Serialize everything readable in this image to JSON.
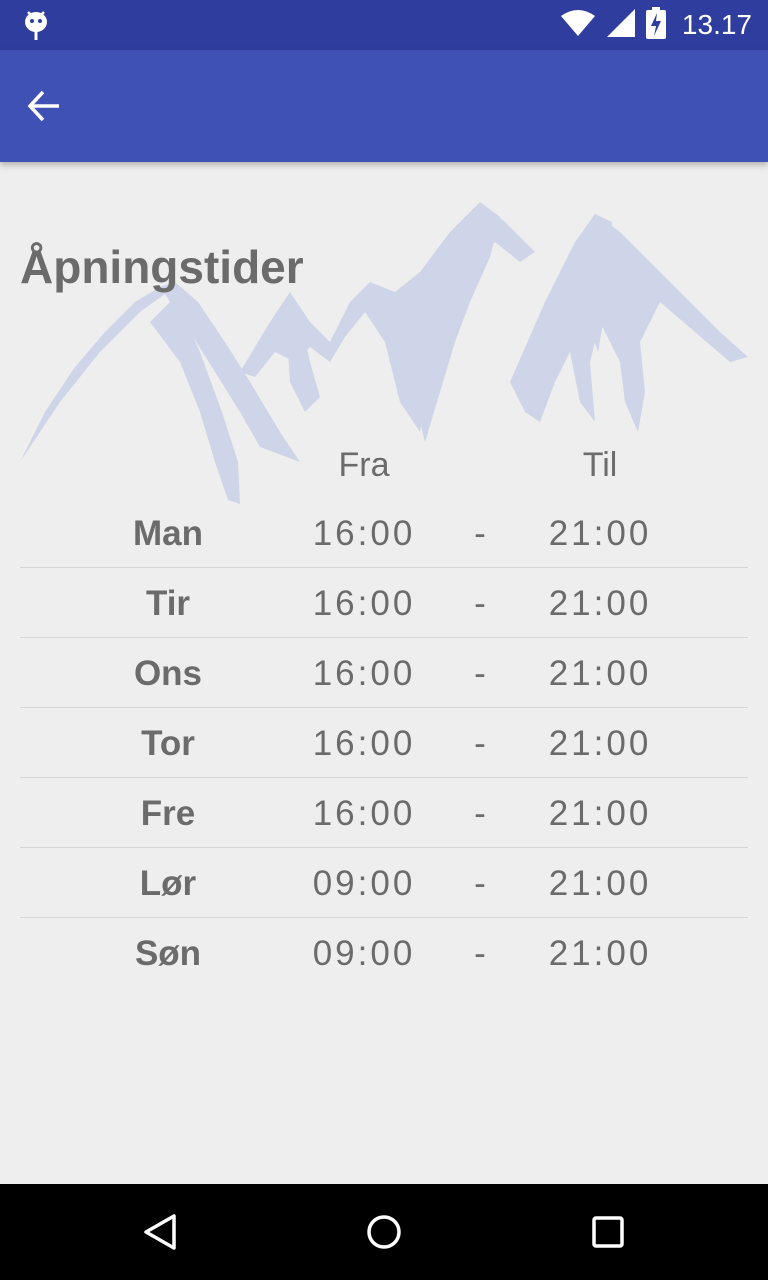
{
  "status_bar": {
    "time": "13.17",
    "icons": [
      "android-debug-icon",
      "wifi-icon",
      "cell-signal-icon",
      "battery-charging-icon"
    ]
  },
  "app_bar": {
    "back_icon": "arrow-back-icon"
  },
  "page": {
    "title": "Åpningstider",
    "columns": {
      "from": "Fra",
      "to": "Til"
    },
    "schedule": [
      {
        "day": "Man",
        "from": "16:00",
        "sep": "-",
        "to": "21:00"
      },
      {
        "day": "Tir",
        "from": "16:00",
        "sep": "-",
        "to": "21:00"
      },
      {
        "day": "Ons",
        "from": "16:00",
        "sep": "-",
        "to": "21:00"
      },
      {
        "day": "Tor",
        "from": "16:00",
        "sep": "-",
        "to": "21:00"
      },
      {
        "day": "Fre",
        "from": "16:00",
        "sep": "-",
        "to": "21:00"
      },
      {
        "day": "Lør",
        "from": "09:00",
        "sep": "-",
        "to": "21:00"
      },
      {
        "day": "Søn",
        "from": "09:00",
        "sep": "-",
        "to": "21:00"
      }
    ]
  },
  "nav_bar": {
    "icons": [
      "nav-back-icon",
      "nav-home-icon",
      "nav-recents-icon"
    ]
  },
  "colors": {
    "status_bar": "#2f3e9e",
    "app_bar": "#3f51b5",
    "background": "#eeeeee",
    "text": "#6b6b6b",
    "mountain": "#cfd5e8"
  }
}
